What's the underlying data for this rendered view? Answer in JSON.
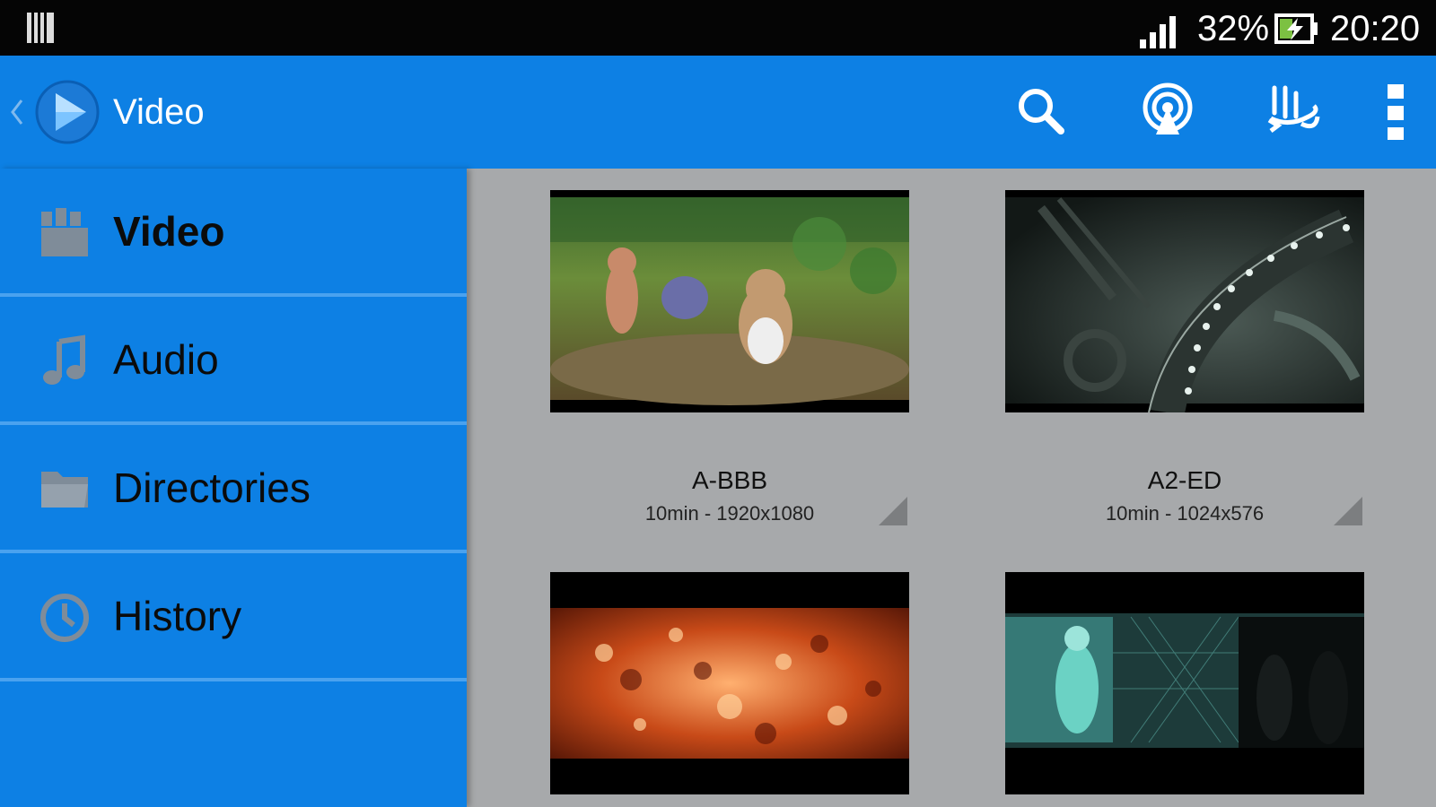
{
  "status_bar": {
    "battery_percent": "32%",
    "time": "20:20",
    "icons": [
      "notification-icon",
      "signal-icon",
      "battery-charging-icon"
    ]
  },
  "action_bar": {
    "title": "Video",
    "icons": [
      "back-chevron-icon",
      "app-play-logo-icon",
      "search-icon",
      "cast-icon",
      "pointer-gesture-icon",
      "overflow-menu-icon"
    ],
    "color": "#0d80e4"
  },
  "drawer": {
    "items": [
      {
        "label": "Video",
        "icon": "clapperboard-icon",
        "active": true
      },
      {
        "label": "Audio",
        "icon": "music-note-icon",
        "active": false
      },
      {
        "label": "Directories",
        "icon": "folder-icon",
        "active": false
      },
      {
        "label": "History",
        "icon": "clock-icon",
        "active": false
      }
    ]
  },
  "videos": [
    {
      "title": "A-BBB",
      "meta": "10min - 1920x1080"
    },
    {
      "title": "A2-ED",
      "meta": "10min - 1024x576"
    },
    {
      "title": "",
      "meta": ""
    },
    {
      "title": "",
      "meta": ""
    }
  ]
}
